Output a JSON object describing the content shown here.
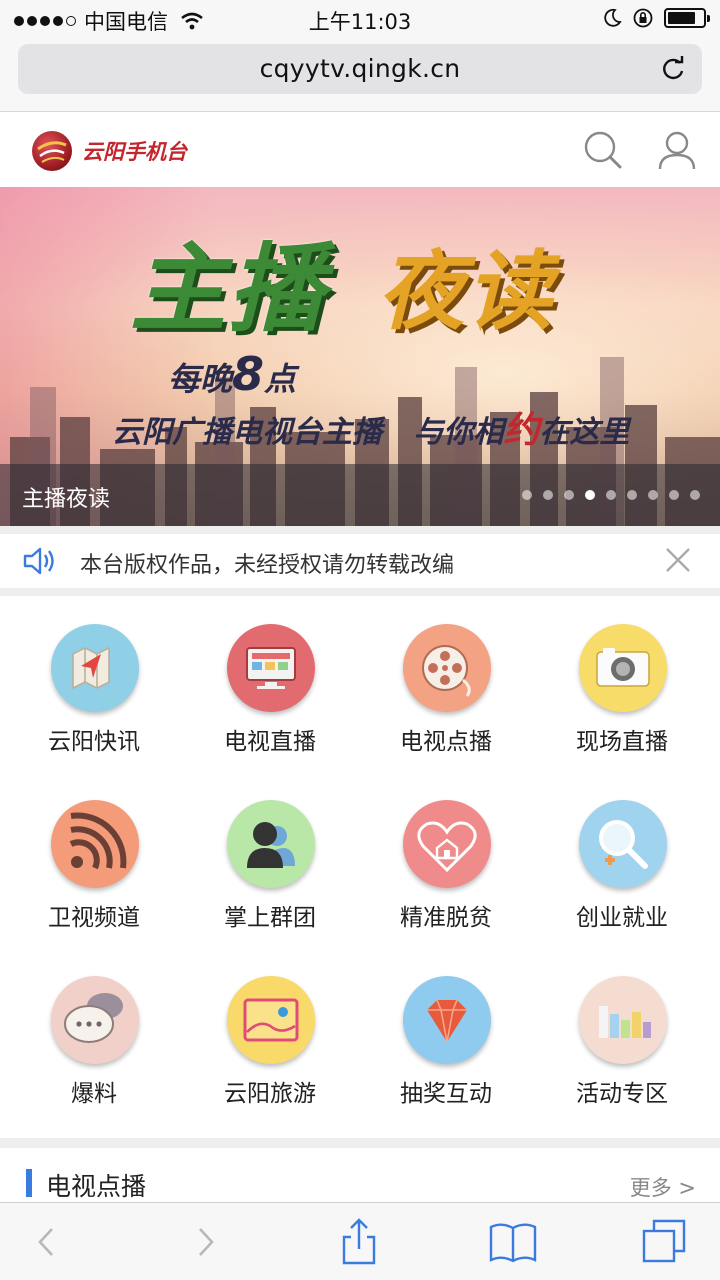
{
  "status_bar": {
    "carrier": "中国电信",
    "time": "上午11:03",
    "signal_bars": 4,
    "battery_level": 0.8
  },
  "browser": {
    "url": "cqyytv.qingk.cn"
  },
  "site": {
    "brand": "云阳手机台"
  },
  "banner": {
    "title_a": "主播",
    "title_b": "夜读",
    "line1_prefix": "每晚",
    "line1_number": "8",
    "line1_suffix": "点",
    "line2_part1": "云阳广播电视台主播",
    "line2_part2": "与你相",
    "line2_highlight": "约",
    "line2_part3": "在这里",
    "caption": "主播夜读",
    "page_count": 9,
    "active_page": 4
  },
  "notice": {
    "text": "本台版权作品，未经授权请勿转载改编"
  },
  "grid": [
    {
      "label": "云阳快讯",
      "icon": "map-icon",
      "color": "#8fd0e6"
    },
    {
      "label": "电视直播",
      "icon": "tv-icon",
      "color": "#e26b6f"
    },
    {
      "label": "电视点播",
      "icon": "film-reel-icon",
      "color": "#f3a283"
    },
    {
      "label": "现场直播",
      "icon": "camera-icon",
      "color": "#f8dc6a"
    },
    {
      "label": "卫视频道",
      "icon": "signal-icon",
      "color": "#f49b7a"
    },
    {
      "label": "掌上群团",
      "icon": "group-icon",
      "color": "#b9e7a7"
    },
    {
      "label": "精准脱贫",
      "icon": "house-heart-icon",
      "color": "#ef8c8b"
    },
    {
      "label": "创业就业",
      "icon": "search-icon",
      "color": "#9fd3ee"
    },
    {
      "label": "爆料",
      "icon": "chat-icon",
      "color": "#f0d0c8"
    },
    {
      "label": "云阳旅游",
      "icon": "picture-icon",
      "color": "#f8d96a"
    },
    {
      "label": "抽奖互动",
      "icon": "diamond-icon",
      "color": "#8fcbee"
    },
    {
      "label": "活动专区",
      "icon": "bar-chart-icon",
      "color": "#f4ddd0"
    }
  ],
  "section": {
    "title": "电视点播",
    "more": "更多 >"
  }
}
